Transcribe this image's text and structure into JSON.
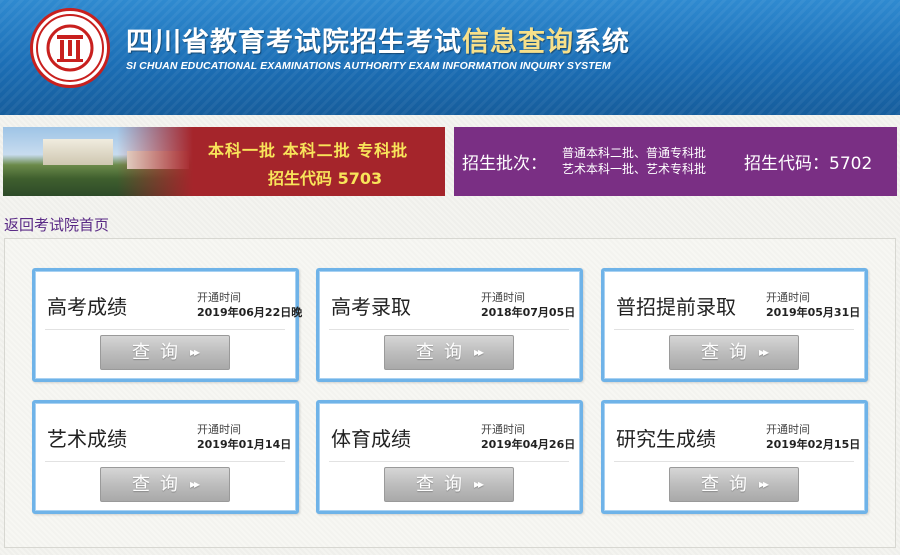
{
  "header": {
    "title_part1": "四川省教育考试院招生考试",
    "title_highlight": "信息查询",
    "title_part2": "系统",
    "subtitle": "SI CHUAN EDUCATIONAL EXAMINATIONS AUTHORITY EXAM INFORMATION INQUIRY SYSTEM"
  },
  "banner_left": {
    "line1": "本科一批  本科二批  专科批",
    "line2": "招生代码 5703"
  },
  "banner_right": {
    "label": "招生批次：",
    "detail_line1": "普通本科二批、普通专科批",
    "detail_line2": "艺术本科一批、艺术专科批",
    "code": "招生代码：5702"
  },
  "back_link": "返回考试院首页",
  "cards": [
    {
      "title": "高考成绩",
      "open_label": "开通时间",
      "open_date": "2019年06月22日晚",
      "button": "查询"
    },
    {
      "title": "高考录取",
      "open_label": "开通时间",
      "open_date": "2018年07月05日",
      "button": "查询"
    },
    {
      "title": "普招提前录取",
      "open_label": "开通时间",
      "open_date": "2019年05月31日",
      "button": "查询"
    },
    {
      "title": "艺术成绩",
      "open_label": "开通时间",
      "open_date": "2019年01月14日",
      "button": "查询"
    },
    {
      "title": "体育成绩",
      "open_label": "开通时间",
      "open_date": "2019年04月26日",
      "button": "查询"
    },
    {
      "title": "研究生成绩",
      "open_label": "开通时间",
      "open_date": "2019年02月15日",
      "button": "查询"
    }
  ],
  "icons": {
    "button_arrow": "double-chevron-right-icon",
    "logo": "emblem-logo"
  },
  "colors": {
    "header_blue": "#1c6fb6",
    "title_highlight": "#f7e08a",
    "banner_red": "#a5252b",
    "banner_purple": "#7a2f84",
    "card_border": "#6fb3e8",
    "banner_text": "#f8e45a"
  }
}
